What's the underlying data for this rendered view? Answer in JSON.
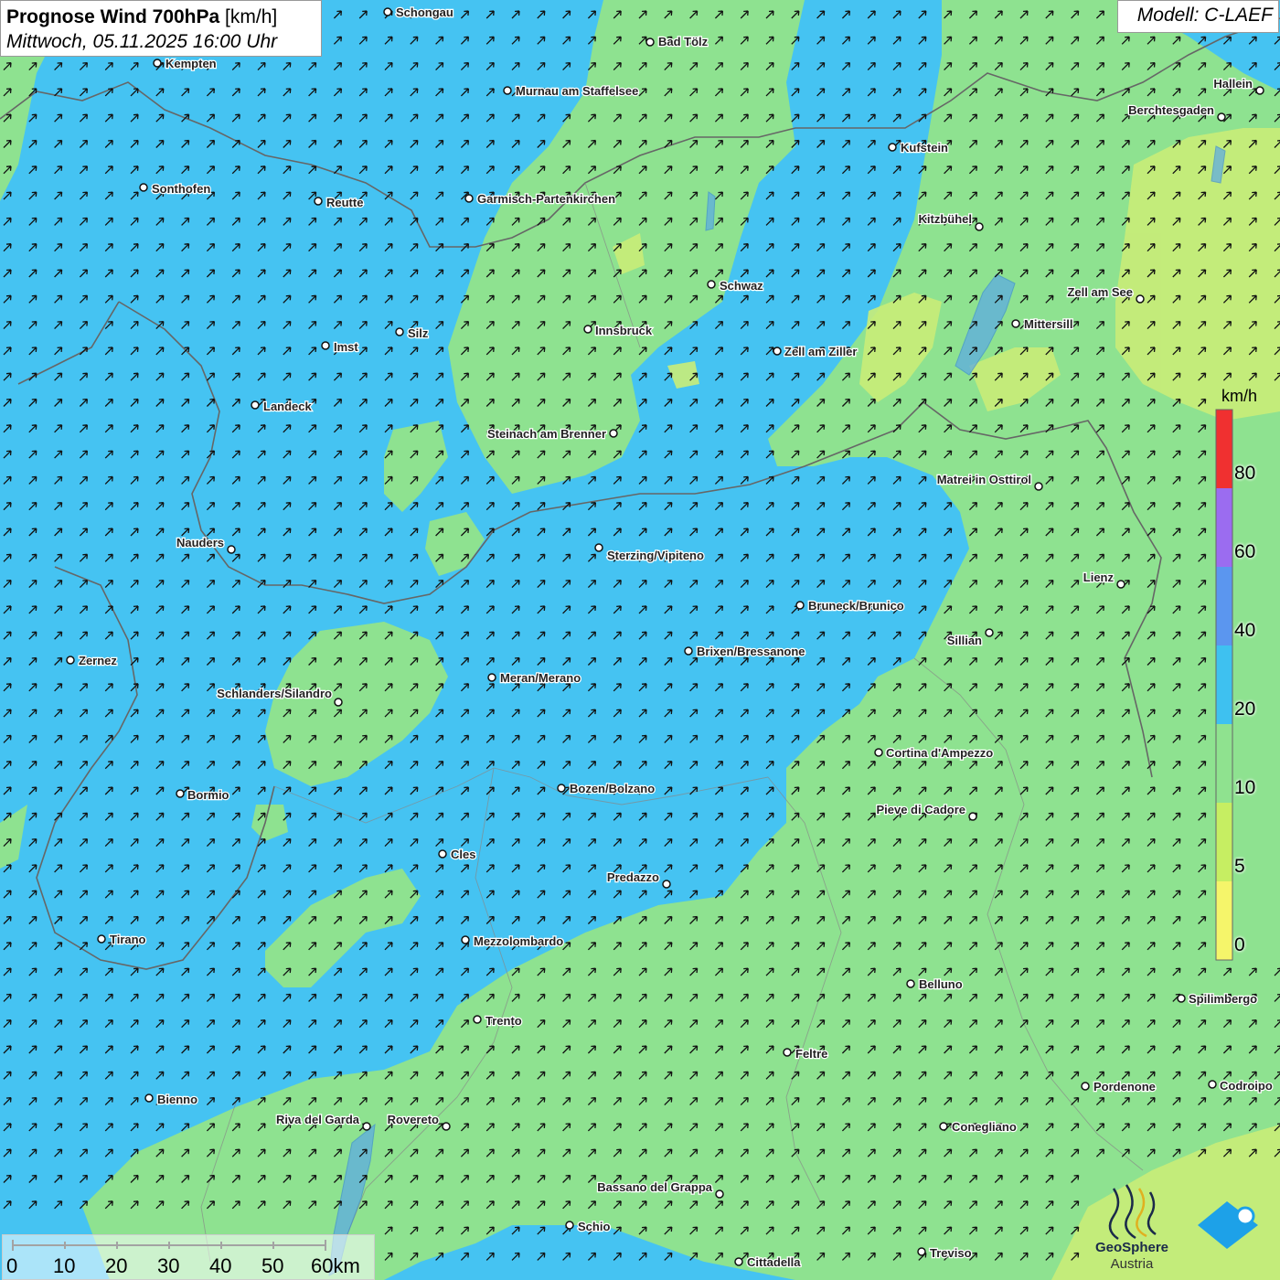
{
  "header": {
    "title": "Prognose Wind 700hPa",
    "unit": "[km/h]",
    "datetime": "Mittwoch, 05.11.2025 16:00 Uhr"
  },
  "model": "Modell: C-LAEF",
  "legend": {
    "unit": "km/h",
    "labels": [
      "80",
      "60",
      "40",
      "20",
      "10",
      "5",
      "0"
    ],
    "colors": {
      "above_80": "#f03030",
      "60_80": "#9b6cf0",
      "40_60": "#5b96ef",
      "20_40": "#3ec1f0",
      "10_20": "#8fe28f",
      "5_10": "#c6ee62",
      "0_5": "#f5f56a"
    }
  },
  "scale": {
    "labels": [
      "0",
      "10",
      "20",
      "30",
      "40",
      "50",
      "60km"
    ]
  },
  "logos": {
    "geosphere_line1": "GeoSphere",
    "geosphere_line2": "Austria"
  },
  "arrow_icon": "wind-arrow-icon",
  "cities": [
    {
      "name": "Schongau"
    },
    {
      "name": "Bad Tölz"
    },
    {
      "name": "Kempten"
    },
    {
      "name": "Murnau am Staffelsee"
    },
    {
      "name": "Hallein"
    },
    {
      "name": "Berchtesgaden"
    },
    {
      "name": "Kufstein"
    },
    {
      "name": "Sonthofen"
    },
    {
      "name": "Reutte"
    },
    {
      "name": "Garmisch-Partenkirchen"
    },
    {
      "name": "Kitzbühel"
    },
    {
      "name": "Schwaz"
    },
    {
      "name": "Zell am See"
    },
    {
      "name": "Mittersill"
    },
    {
      "name": "Innsbruck"
    },
    {
      "name": "Silz"
    },
    {
      "name": "Imst"
    },
    {
      "name": "Zell am Ziller"
    },
    {
      "name": "Landeck"
    },
    {
      "name": "Steinach am Brenner"
    },
    {
      "name": "Matrei in Osttirol"
    },
    {
      "name": "Nauders"
    },
    {
      "name": "Sterzing/Vipiteno"
    },
    {
      "name": "Lienz"
    },
    {
      "name": "Bruneck/Brunico"
    },
    {
      "name": "Sillian"
    },
    {
      "name": "Brixen/Bressanone"
    },
    {
      "name": "Zernez"
    },
    {
      "name": "Meran/Merano"
    },
    {
      "name": "Schlanders/Silandro"
    },
    {
      "name": "Cortina d'Ampezzo"
    },
    {
      "name": "Bormio"
    },
    {
      "name": "Bozen/Bolzano"
    },
    {
      "name": "Pieve di Cadore"
    },
    {
      "name": "Cles"
    },
    {
      "name": "Predazzo"
    },
    {
      "name": "Tirano"
    },
    {
      "name": "Mezzolombardo"
    },
    {
      "name": "Belluno"
    },
    {
      "name": "Spilimbergo"
    },
    {
      "name": "Trento"
    },
    {
      "name": "Feltre"
    },
    {
      "name": "Bienno"
    },
    {
      "name": "Pordenone"
    },
    {
      "name": "Codroipo"
    },
    {
      "name": "Riva del Garda"
    },
    {
      "name": "Rovereto"
    },
    {
      "name": "Conegliano"
    },
    {
      "name": "Bassano del Grappa"
    },
    {
      "name": "Schio"
    },
    {
      "name": "Treviso"
    },
    {
      "name": "Cittadella"
    }
  ]
}
